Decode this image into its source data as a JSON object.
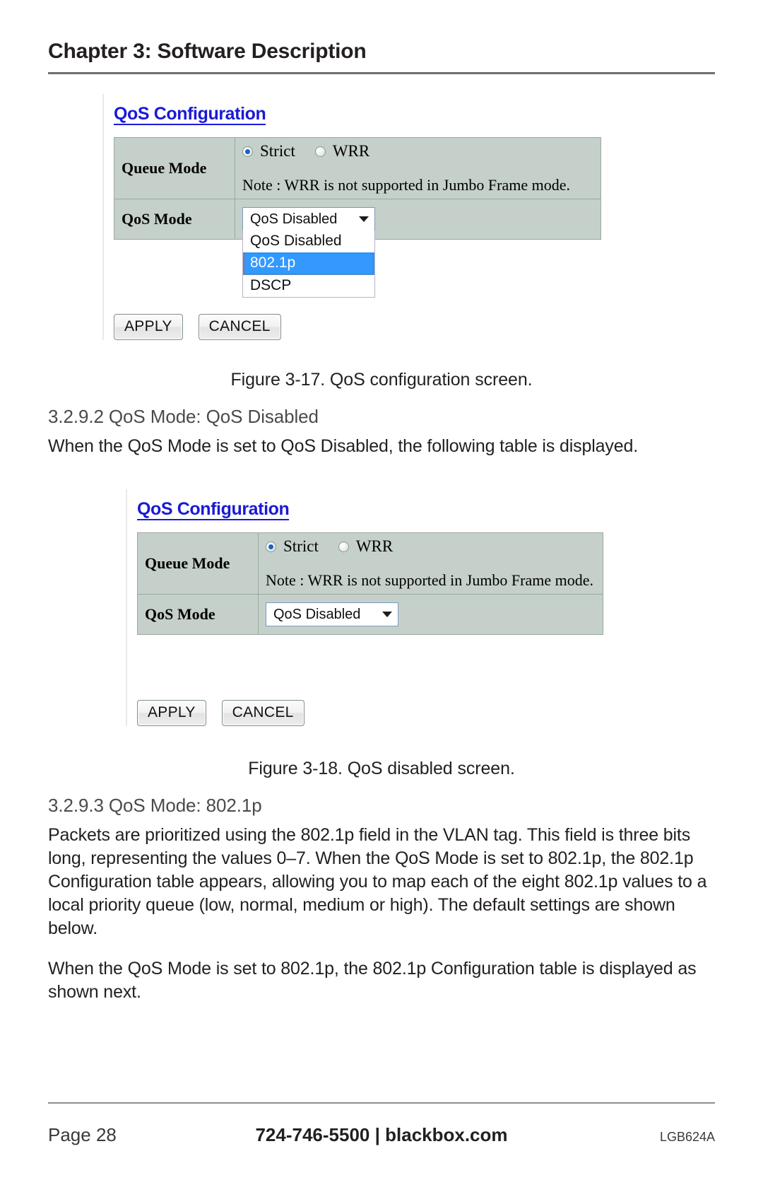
{
  "header": {
    "chapter": "Chapter 3: Software Description"
  },
  "figure1": {
    "screen_title": "QoS Configuration",
    "rows": [
      {
        "label": "Queue Mode"
      },
      {
        "label": "QoS Mode"
      }
    ],
    "queue_mode": {
      "options": [
        {
          "label": "Strict",
          "selected": true
        },
        {
          "label": "WRR",
          "selected": false
        }
      ],
      "note": "Note : WRR is not supported in Jumbo Frame mode."
    },
    "qos_mode": {
      "selected": "QoS Disabled",
      "dropdown_open": true,
      "options": [
        "QoS Disabled",
        "802.1p",
        "DSCP"
      ],
      "highlighted": "802.1p"
    },
    "buttons": {
      "apply": "APPLY",
      "cancel": "CANCEL"
    },
    "caption": "Figure 3-17. QoS configuration screen."
  },
  "section_3292": {
    "heading": "3.2.9.2 QoS Mode: QoS Disabled",
    "paragraph": "When the QoS Mode is set to QoS Disabled, the following table is displayed."
  },
  "figure2": {
    "screen_title": "QoS Configuration",
    "rows": [
      {
        "label": "Queue Mode"
      },
      {
        "label": "QoS Mode"
      }
    ],
    "queue_mode": {
      "options": [
        {
          "label": "Strict",
          "selected": true
        },
        {
          "label": "WRR",
          "selected": false
        }
      ],
      "note": "Note : WRR is not supported in Jumbo Frame mode."
    },
    "qos_mode": {
      "selected": "QoS Disabled",
      "dropdown_open": false
    },
    "buttons": {
      "apply": "APPLY",
      "cancel": "CANCEL"
    },
    "caption": "Figure 3-18. QoS disabled screen."
  },
  "section_3293": {
    "heading": "3.2.9.3 QoS Mode: 802.1p",
    "paragraph1": "Packets are prioritized using the 802.1p field in the VLAN tag. This field is three bits long, representing the values 0–7. When the QoS Mode is set to 802.1p, the 802.1p Configuration table appears, allowing you to map each of the eight 802.1p values to a local priority queue (low, normal, medium or high). The default settings are shown below.",
    "paragraph2": "When the QoS Mode is set to 802.1p, the 802.1p Configuration table is displayed as shown next."
  },
  "footer": {
    "page": "Page 28",
    "phone": "724-746-5500",
    "separator": "|",
    "site": "blackbox.com",
    "model": "LGB624A"
  },
  "colors": {
    "screen_title": "#1a1ad6",
    "table_bg": "#c5d0ca",
    "table_border": "#9aa8a1",
    "highlight": "#3399ff",
    "radio_dot": "#1664c8"
  }
}
